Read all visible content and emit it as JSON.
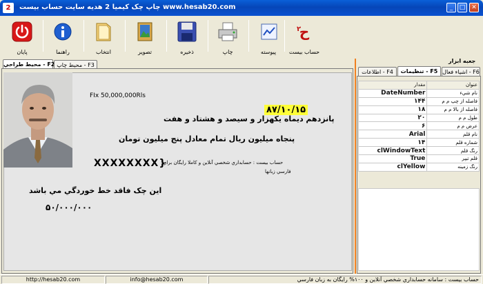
{
  "window": {
    "title": "چاپ چک کیمیا 2 هدیه سایت حساب بیست www.hesab20.com",
    "icon_label": "2"
  },
  "toolbar": {
    "exit": "پايان",
    "help": "راهنما",
    "select": "انتخاب",
    "image": "تصوير",
    "save": "ذخيره",
    "print": "چاپ",
    "attach": "پيوسته",
    "hesab20": "حساب بيست"
  },
  "left_tabs": {
    "design": "محيط طراحي - F2",
    "print": "محيط چاپ - F3"
  },
  "cheque": {
    "amount_label": "FIx 50,000,000Rls",
    "date": "۸۷/۱۰/۱۵",
    "date_words": "پانزدهم ديماه يكهزار و سيصد و هشتاد و هفت",
    "amount_words": "پنجاه ميليون  ريال تمام معادل پنج ميليون تومان",
    "payee": "XXXXXXXX}",
    "desc_line1": "حساب بيست : حسابداري شخصي آنلاين و كاملا رايگان براي",
    "desc_line2": "فارسي زبانها",
    "no_cross": "اين چک فاقد خط خوردگي مي باشد",
    "amount_digits": "۵۰/۰۰۰/۰۰۰"
  },
  "right_panel": {
    "title": "جعبه ابزار",
    "tabs": {
      "objects": "اشياء فعال - F6",
      "settings": "تنظيمات - F5",
      "info": "اطلاعات - F4"
    },
    "grid": {
      "header_key": "عنوان",
      "header_value": "مقدار",
      "rows": [
        {
          "key": "نام شيء",
          "value": "DateNumber"
        },
        {
          "key": "فاصله از چپ م م",
          "value": "۱۴۴"
        },
        {
          "key": "فاصله از بالا م م",
          "value": "۱۸"
        },
        {
          "key": "طول م م",
          "value": "۲۰"
        },
        {
          "key": "عرض م م",
          "value": "۶"
        },
        {
          "key": "نام قلم",
          "value": "Arial"
        },
        {
          "key": "شماره قلم",
          "value": "۱۴"
        },
        {
          "key": "رنگ قلم",
          "value": "clWindowText"
        },
        {
          "key": "قلم تيپر",
          "value": "True"
        },
        {
          "key": "رنگ زمينه",
          "value": "clYellow"
        }
      ]
    }
  },
  "statusbar": {
    "url": "http://hesab20.com",
    "email": "info@hesab20.com",
    "status": "حساب بيست : سامانه حسابداري شخصي آنلاين و ۱۰۰% رايگان به زبان فارسي"
  },
  "colors": {
    "titlebar": "#0a51d0",
    "date_highlight": "#ffff38",
    "divider": "#f08020"
  }
}
